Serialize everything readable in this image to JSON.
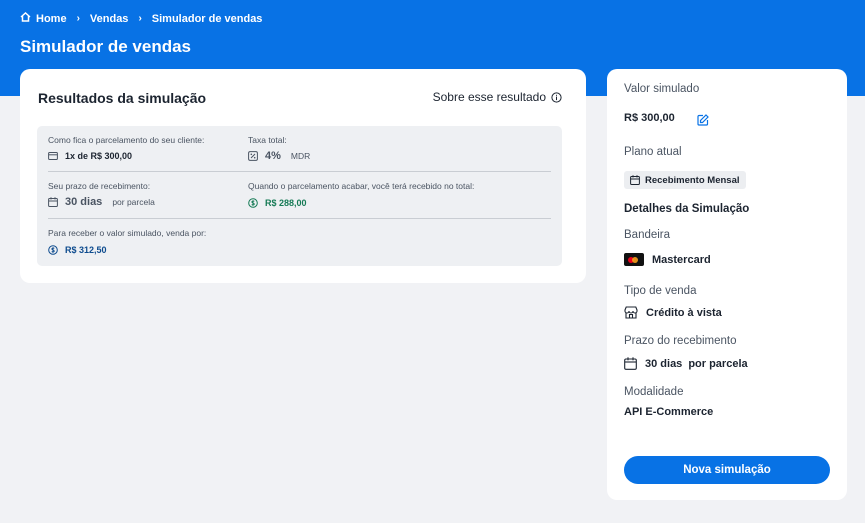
{
  "breadcrumb": {
    "home": "Home",
    "sales": "Vendas",
    "current": "Simulador de vendas"
  },
  "page_title": "Simulador de vendas",
  "results": {
    "title": "Resultados da simulação",
    "about_link": "Sobre esse resultado",
    "installment_label": "Como fica o parcelamento do seu cliente:",
    "installment_value": "1x de R$ 300,00",
    "rate_label": "Taxa total:",
    "rate_value": "4%",
    "rate_unit": "MDR",
    "term_label": "Seu prazo de recebimento:",
    "term_value": "30 dias",
    "term_unit": "por parcela",
    "total_label": "Quando o parcelamento acabar, você terá recebido no total:",
    "total_value": "R$ 288,00",
    "receive_label": "Para receber o valor simulado, venda por:",
    "receive_value": "R$ 312,50"
  },
  "summary": {
    "simulated_label": "Valor simulado",
    "simulated_value": "R$ 300,00",
    "plan_label": "Plano atual",
    "plan_value": "Recebimento Mensal",
    "details_title": "Detalhes da Simulação",
    "brand_label": "Bandeira",
    "brand_value": "Mastercard",
    "sale_type_label": "Tipo de venda",
    "sale_type_value": "Crédito à vista",
    "term_label": "Prazo do recebimento",
    "term_value": "30 dias",
    "term_unit": "por parcela",
    "modality_label": "Modalidade",
    "modality_value": "API E-Commerce",
    "new_button": "Nova simulação"
  },
  "colors": {
    "primary": "#0872e5",
    "positive": "#157a55",
    "background": "#f1f2f5"
  }
}
